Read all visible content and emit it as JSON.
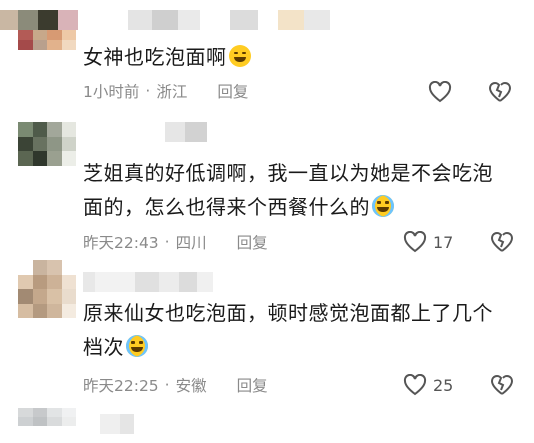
{
  "comments": [
    {
      "text": "女神也吃泡面啊",
      "emoji": "grin-emoji",
      "time": "1小时前",
      "location": "浙江",
      "reply": "回复",
      "likes": ""
    },
    {
      "text": "芝姐真的好低调啊，我一直以为她是不会吃泡面的，怎么也得来个西餐什么的",
      "emoji": "laugh-cry-emoji",
      "time": "昨天22:43",
      "location": "四川",
      "reply": "回复",
      "likes": "17"
    },
    {
      "text": "原来仙女也吃泡面，顿时感觉泡面都上了几个档次",
      "emoji": "laugh-cry-emoji",
      "time": "昨天22:25",
      "location": "安徽",
      "reply": "回复",
      "likes": "25"
    }
  ],
  "colors": {
    "text": "#1a1a1a",
    "meta": "#8a8a8a",
    "icon": "#555555"
  }
}
